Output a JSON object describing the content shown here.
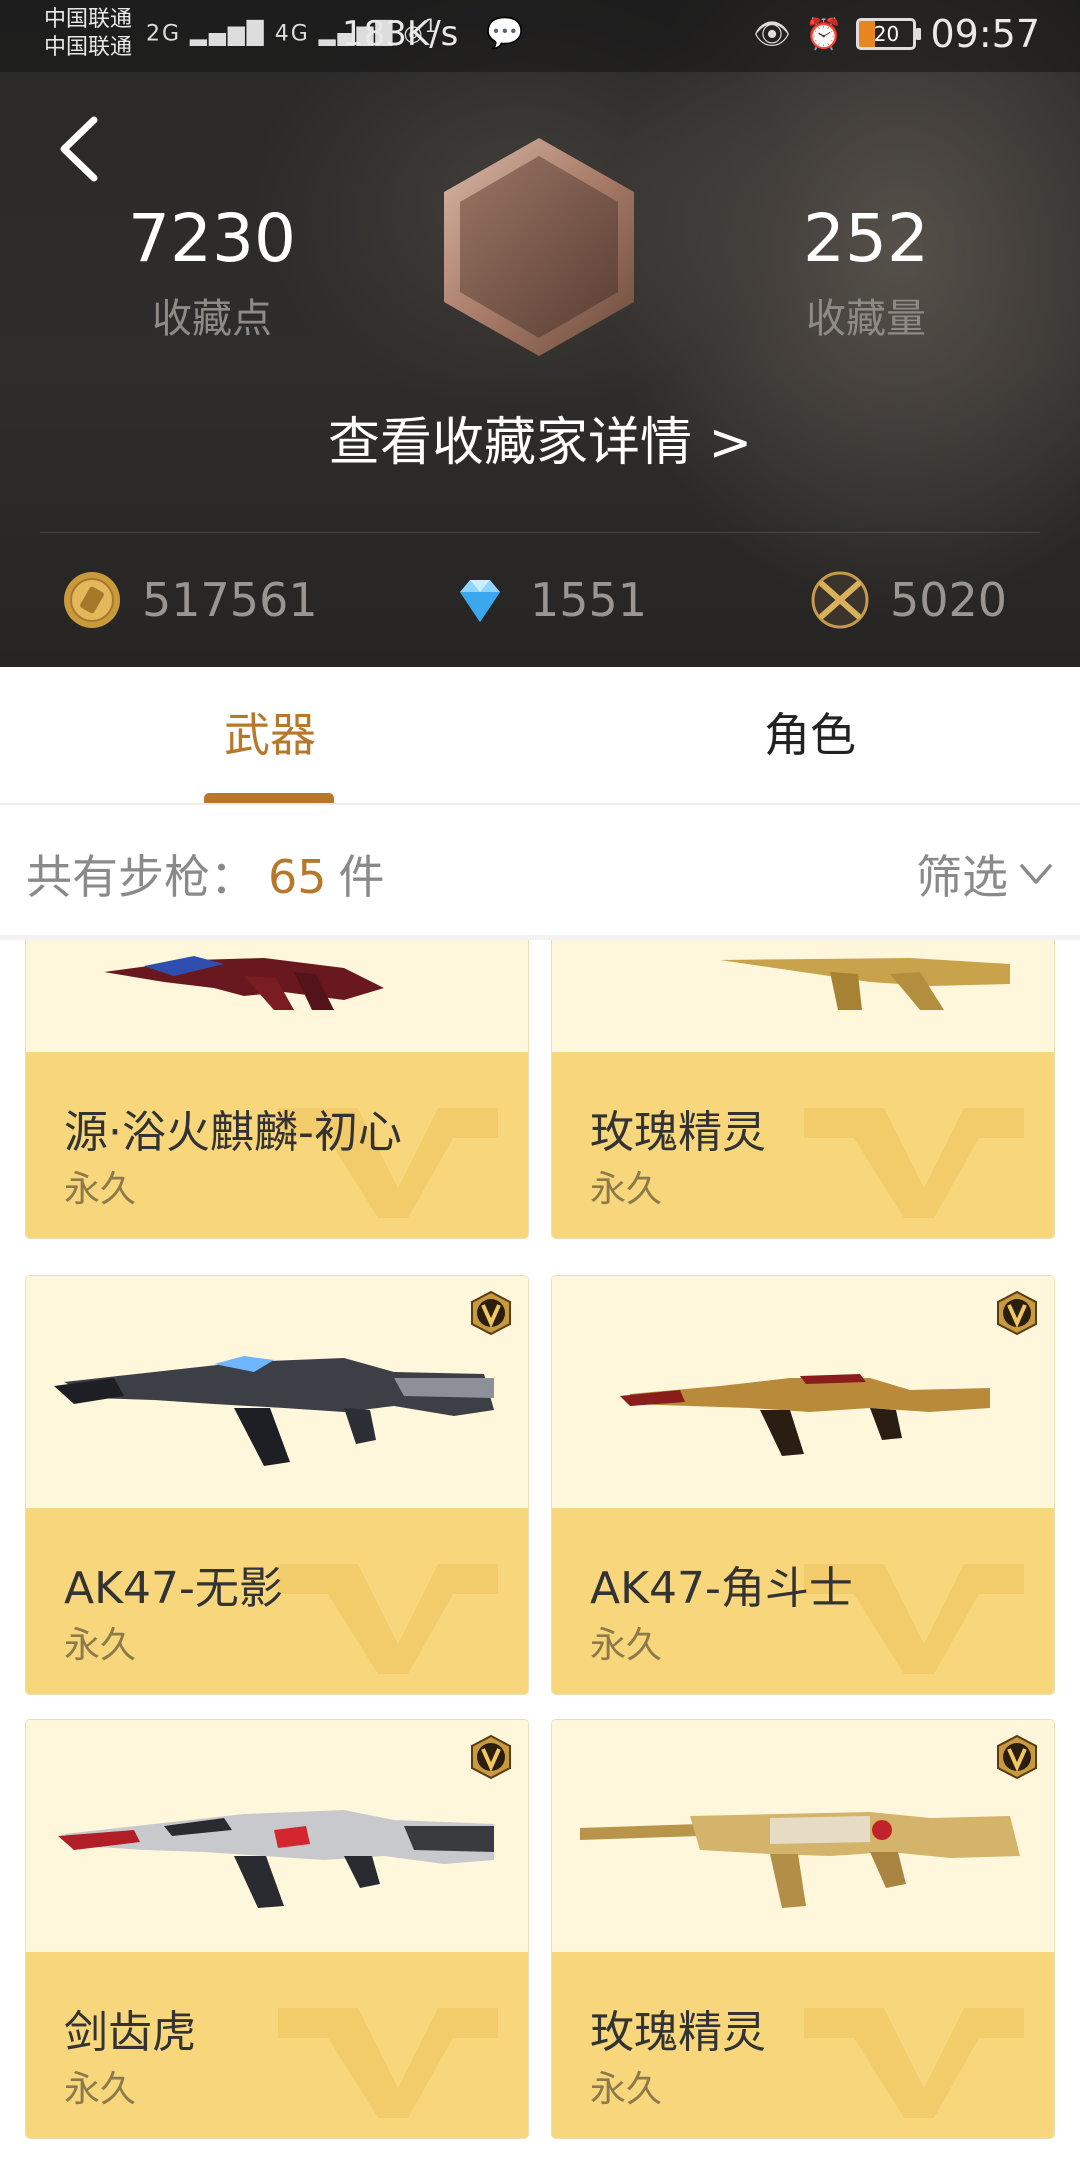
{
  "status_bar": {
    "carrier_1": "中国联通",
    "carrier_2": "中国联通",
    "network_1": "2G",
    "network_2": "4G",
    "hotspot_count": "1",
    "speed": "183K/s",
    "battery": "20",
    "time": "09:57"
  },
  "profile": {
    "collect_points": "7230",
    "collect_points_label": "收藏点",
    "collect_count": "252",
    "collect_count_label": "收藏量",
    "detail_link": "查看收藏家详情 >"
  },
  "currencies": [
    {
      "icon": "gold-coin-icon",
      "value": "517561"
    },
    {
      "icon": "diamond-icon",
      "value": "1551"
    },
    {
      "icon": "crossed-guns-icon",
      "value": "5020"
    }
  ],
  "tabs": [
    {
      "label": "武器",
      "active": true
    },
    {
      "label": "角色",
      "active": false
    }
  ],
  "summary": {
    "prefix": "共有步枪：",
    "count": "65",
    "suffix": "件",
    "filter_label": "筛选"
  },
  "items": [
    {
      "name": "源·浴火麒麟-初心",
      "duration": "永久",
      "vip": false
    },
    {
      "name": "玫瑰精灵",
      "duration": "永久",
      "vip": false
    },
    {
      "name": "AK47-无影",
      "duration": "永久",
      "vip": true
    },
    {
      "name": "AK47-角斗士",
      "duration": "永久",
      "vip": true
    },
    {
      "name": "剑齿虎",
      "duration": "永久",
      "vip": true
    },
    {
      "name": "玫瑰精灵",
      "duration": "永久",
      "vip": true
    }
  ],
  "colors": {
    "accent": "#b8782b",
    "card_info_bg": "#f8d77c",
    "card_img_bg": "#fff7db",
    "header_bg": "#2a2928"
  }
}
